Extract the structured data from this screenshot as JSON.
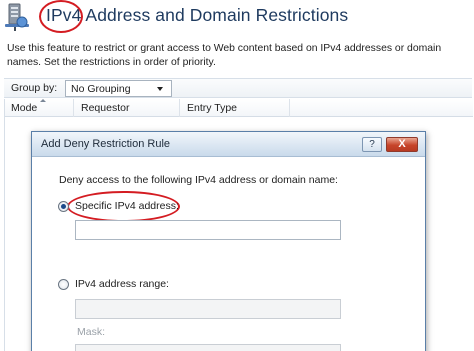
{
  "page": {
    "title_ring": "IPv4",
    "title_rest": " Address and Domain Restrictions",
    "description": "Use this feature to restrict or grant access to Web content based on IPv4 addresses or domain names. Set the restrictions in order of priority."
  },
  "toolbar": {
    "group_label": "Group by:",
    "group_value": "No Grouping"
  },
  "grid": {
    "columns": [
      "Mode",
      "Requestor",
      "Entry Type"
    ]
  },
  "dialog": {
    "title": "Add Deny Restriction Rule",
    "help_label": "?",
    "close_label": "X",
    "prompt": "Deny access to the following IPv4 address or domain name:",
    "specific_label": "Specific IPv4 address:",
    "specific_value": "",
    "range_label": "IPv4 address range:",
    "range_value": "",
    "mask_label": "Mask:",
    "mask_value": ""
  },
  "colors": {
    "annotation_ring": "#d41c22",
    "title_text": "#1e3a5f",
    "close_button": "#c7452b"
  },
  "icons": [
    "server-network-icon",
    "dropdown-arrow-icon",
    "sort-arrow-icon",
    "help-icon",
    "close-icon"
  ]
}
